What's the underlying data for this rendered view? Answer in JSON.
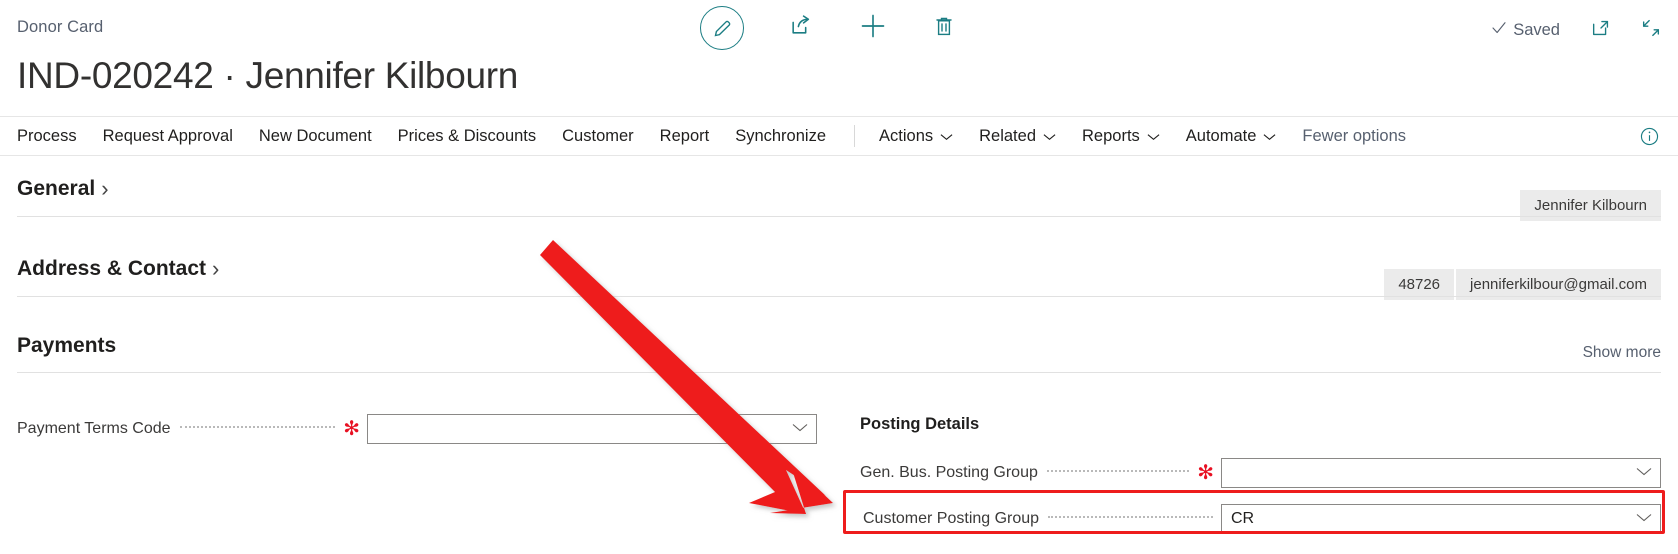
{
  "header": {
    "breadcrumb": "Donor Card",
    "title": "IND-020242 · Jennifer Kilbourn",
    "saved_label": "Saved",
    "check_icon": "check-icon",
    "icons": [
      {
        "name": "edit-pencil-icon",
        "glyph": "pencil"
      },
      {
        "name": "share-icon",
        "glyph": "share"
      },
      {
        "name": "new-plus-icon",
        "glyph": "plus"
      },
      {
        "name": "delete-trash-icon",
        "glyph": "trash"
      }
    ],
    "right_icons": [
      {
        "name": "open-in-new-window-icon"
      },
      {
        "name": "collapse-window-icon"
      }
    ]
  },
  "ribbon": {
    "items": [
      {
        "label": "Process",
        "has_chevron": false,
        "muted": false
      },
      {
        "label": "Request Approval",
        "has_chevron": false,
        "muted": false
      },
      {
        "label": "New Document",
        "has_chevron": false,
        "muted": false
      },
      {
        "label": "Prices & Discounts",
        "has_chevron": false,
        "muted": false
      },
      {
        "label": "Customer",
        "has_chevron": false,
        "muted": false
      },
      {
        "label": "Report",
        "has_chevron": false,
        "muted": false
      },
      {
        "label": "Synchronize",
        "has_chevron": false,
        "muted": false
      }
    ],
    "items2": [
      {
        "label": "Actions",
        "has_chevron": true,
        "muted": false
      },
      {
        "label": "Related",
        "has_chevron": true,
        "muted": false
      },
      {
        "label": "Reports",
        "has_chevron": true,
        "muted": false
      },
      {
        "label": "Automate",
        "has_chevron": true,
        "muted": false
      },
      {
        "label": "Fewer options",
        "has_chevron": false,
        "muted": true
      }
    ],
    "info_icon": "info-circle-icon"
  },
  "sections": {
    "general": {
      "title": "General",
      "caret": "›",
      "badges": [
        "Jennifer Kilbourn"
      ]
    },
    "address": {
      "title": "Address & Contact",
      "caret": "›",
      "badges": [
        "48726",
        "jenniferkilbour@gmail.com"
      ]
    },
    "payments": {
      "title": "Payments",
      "show_more": "Show more"
    }
  },
  "form": {
    "payment_terms": {
      "label": "Payment Terms Code",
      "required": true,
      "value": "",
      "placeholder": ""
    },
    "posting_details_heading": "Posting Details",
    "gen_bus_posting_group": {
      "label": "Gen. Bus. Posting Group",
      "required": true,
      "value": "",
      "placeholder": ""
    },
    "customer_posting_group": {
      "label": "Customer Posting Group",
      "required": false,
      "value": "CR",
      "placeholder": ""
    }
  },
  "annotations": {
    "arrow_color": "#ee1c1c",
    "highlight_color": "#ee1c1c",
    "arrow_name": "red-annotation-arrow",
    "highlight_name": "red-highlight-box"
  },
  "colors": {
    "accent_teal": "#1b7d83",
    "required_red": "#e81123",
    "badge_bg": "#ebebeb",
    "text": "#201f1e"
  }
}
